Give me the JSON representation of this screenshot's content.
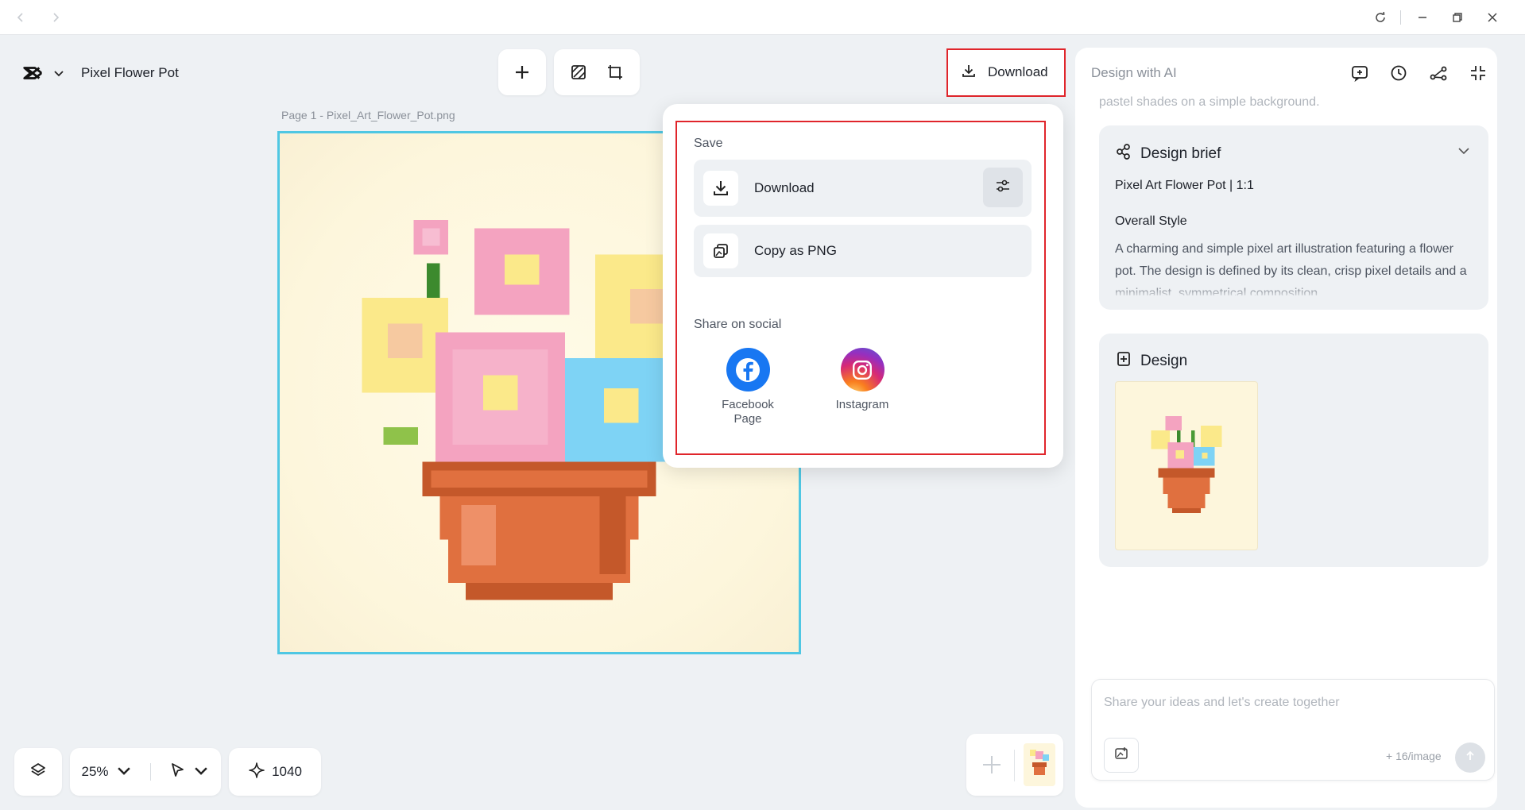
{
  "document": {
    "title": "Pixel Flower Pot"
  },
  "canvas": {
    "page_label": "Page 1 -  Pixel_Art_Flower_Pot.png",
    "zoom": "25%",
    "credits": "1040"
  },
  "header": {
    "download_label": "Download"
  },
  "download_menu": {
    "save_title": "Save",
    "download_label": "Download",
    "copy_png_label": "Copy as PNG",
    "share_title": "Share on social",
    "facebook_label": "Facebook Page",
    "instagram_label": "Instagram"
  },
  "ai_panel": {
    "title": "Design with AI",
    "previous_text": "pastel shades on a simple background.",
    "brief": {
      "heading": "Design brief",
      "subtitle": "Pixel Art Flower Pot | 1:1",
      "style_heading": "Overall Style",
      "style_text": "A charming and simple pixel art illustration featuring a flower pot. The design is defined by its clean, crisp pixel details and a minimalist, symmetrical composition."
    },
    "design": {
      "heading": "Design"
    },
    "input": {
      "placeholder": "Share your ideas and let's create together",
      "cost": "+ 16/image"
    }
  },
  "colors": {
    "accent_highlight": "#e0252b",
    "artboard_border": "#4fc7e3",
    "facebook": "#1877f2",
    "instagram_gradient": [
      "#feda75",
      "#fa7e1e",
      "#d62976",
      "#962fbf",
      "#4f5bd5"
    ],
    "pot": "#e0703f",
    "pink_flower": "#f4a3c0",
    "yellow_flower": "#fbe98a",
    "blue_flower": "#7ed3f5"
  },
  "icons": [
    "back-arrow-icon",
    "forward-arrow-icon",
    "refresh-icon",
    "minimize-icon",
    "restore-icon",
    "close-icon",
    "app-logo-icon",
    "chevron-down-icon",
    "plus-icon",
    "remove-background-icon",
    "crop-resize-icon",
    "download-icon",
    "sliders-icon",
    "copy-image-icon",
    "facebook-icon",
    "instagram-icon",
    "layers-icon",
    "pointer-icon",
    "sparkle-icon",
    "new-chat-icon",
    "history-icon",
    "share-icon",
    "collapse-icon",
    "design-brief-icon",
    "design-icon",
    "image-upload-icon",
    "send-arrow-icon"
  ]
}
